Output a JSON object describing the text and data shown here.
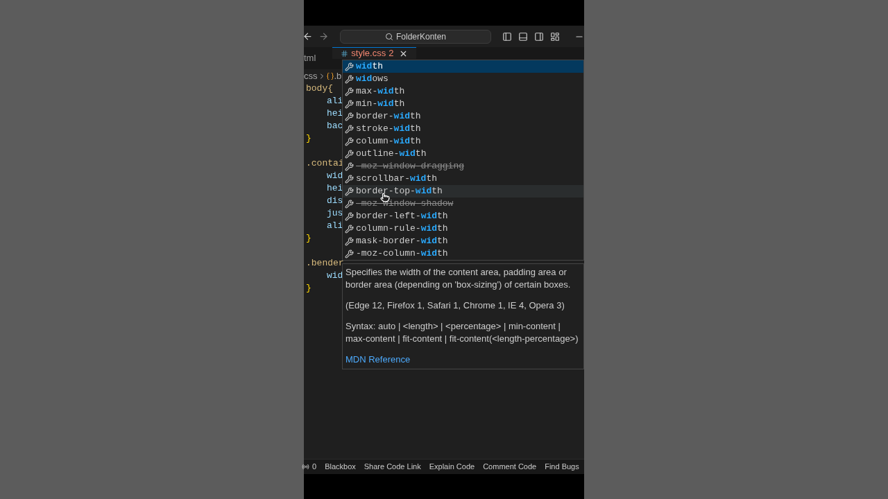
{
  "title_bar": {
    "search": "FolderKonten"
  },
  "tabs": [
    {
      "label": "tml",
      "selected": false
    },
    {
      "label": "style.css",
      "badge": "2",
      "selected": true
    }
  ],
  "breadcrumb": {
    "folder": "css",
    "symbol": ".b"
  },
  "code_lines": [
    {
      "kind": "selector",
      "text": "body{"
    },
    {
      "kind": "property",
      "text": "ali"
    },
    {
      "kind": "property",
      "text": "hei"
    },
    {
      "kind": "property",
      "text": "bac"
    },
    {
      "kind": "brace",
      "text": "}"
    },
    {
      "kind": "blank"
    },
    {
      "kind": "selector",
      "text": ".contai"
    },
    {
      "kind": "property",
      "text": "wid"
    },
    {
      "kind": "property",
      "text": "hei"
    },
    {
      "kind": "property",
      "text": "dis"
    },
    {
      "kind": "property",
      "text": "jus"
    },
    {
      "kind": "property",
      "text": "ali"
    },
    {
      "kind": "brace",
      "text": "}"
    },
    {
      "kind": "blank"
    },
    {
      "kind": "selector",
      "text": ".bender"
    },
    {
      "kind": "property",
      "text": "wid"
    },
    {
      "kind": "brace",
      "text": "}"
    }
  ],
  "suggestions": [
    {
      "kind": "match",
      "match": "wid",
      "after": "th",
      "selected": true,
      "hovered": false
    },
    {
      "kind": "match",
      "match": "wid",
      "after": "ows",
      "selected": false,
      "hovered": false
    },
    {
      "kind": "match",
      "before": "max-",
      "match": "wid",
      "after": "th",
      "selected": false,
      "hovered": false
    },
    {
      "kind": "match",
      "before": "min-",
      "match": "wid",
      "after": "th",
      "selected": false,
      "hovered": false
    },
    {
      "kind": "match",
      "before": "border-",
      "match": "wid",
      "after": "th",
      "selected": false,
      "hovered": false
    },
    {
      "kind": "match",
      "before": "stroke-",
      "match": "wid",
      "after": "th",
      "selected": false,
      "hovered": false
    },
    {
      "kind": "match",
      "before": "column-",
      "match": "wid",
      "after": "th",
      "selected": false,
      "hovered": false
    },
    {
      "kind": "match",
      "before": "outline-",
      "match": "wid",
      "after": "th",
      "selected": false,
      "hovered": false
    },
    {
      "kind": "deprecated",
      "before": "-moz-window-dragging",
      "selected": false,
      "hovered": false
    },
    {
      "kind": "match",
      "before": "scrollbar-",
      "match": "wid",
      "after": "th",
      "selected": false,
      "hovered": false
    },
    {
      "kind": "match",
      "before": "border-top-",
      "match": "wid",
      "after": "th",
      "selected": false,
      "hovered": true
    },
    {
      "kind": "deprecated",
      "before": "-moz-window-shadow",
      "selected": false,
      "hovered": false
    },
    {
      "kind": "match",
      "before": "border-left-",
      "match": "wid",
      "after": "th",
      "selected": false,
      "hovered": false
    },
    {
      "kind": "match",
      "before": "column-rule-",
      "match": "wid",
      "after": "th",
      "selected": false,
      "hovered": false
    },
    {
      "kind": "match",
      "before": "mask-border-",
      "match": "wid",
      "after": "th",
      "selected": false,
      "hovered": false
    },
    {
      "kind": "match",
      "before": "-moz-column-",
      "match": "wid",
      "after": "th",
      "selected": false,
      "hovered": false
    }
  ],
  "details": {
    "description": "Specifies the width of the content area, padding area or border area (depending on 'box-sizing') of certain boxes.",
    "browsers": "(Edge 12, Firefox 1, Safari 1, Chrome 1, IE 4, Opera 3)",
    "syntax": "Syntax: auto | <length> | <percentage> | min-content | max-content | fit-content | fit-content(<length-percentage>)",
    "link": "MDN Reference"
  },
  "status_bar": {
    "count": "0",
    "items": [
      "Blackbox",
      "Share Code Link",
      "Explain Code",
      "Comment Code",
      "Find Bugs"
    ]
  }
}
